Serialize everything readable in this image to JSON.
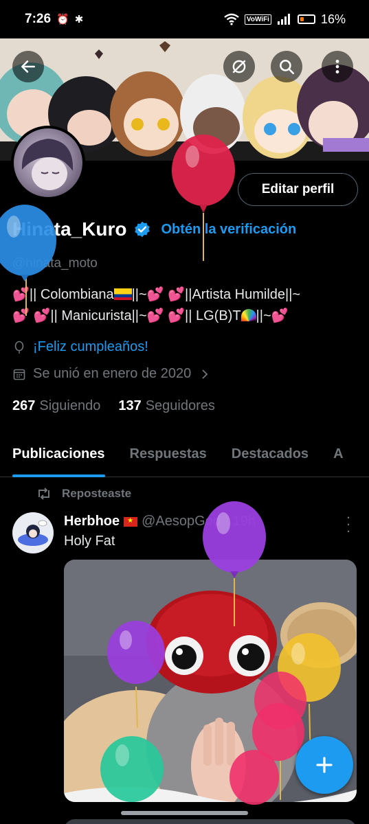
{
  "status_bar": {
    "time": "7:26",
    "alarm_icon": "alarm-icon",
    "bluetooth_icon": "bluetooth-icon",
    "wifi_icon": "wifi-icon",
    "vowifi_label": "VoWiFi",
    "signal_icon": "signal-icon",
    "battery_percent": "16%"
  },
  "header": {
    "back_icon": "back-arrow-icon",
    "mute_icon": "muted-icon",
    "search_icon": "search-icon",
    "more_icon": "more-vertical-icon"
  },
  "profile": {
    "display_name": "Hinata_Kuro",
    "verified_badge": "verified-badge-icon",
    "get_verified_label": "Obtén la verificación",
    "handle": "@hinata_moto",
    "edit_button": "Editar perfil",
    "bio_line1_a": "|| Colombiana",
    "bio_line1_b": "||~",
    "bio_line1_c": "||Artista Humilde||~",
    "bio_line2_a": "|| Manicurista||~",
    "bio_line2_b": "|| LG(B)T",
    "bio_line2_c": "||~",
    "birthday_text": "¡Feliz cumpleaños!",
    "joined_text": "Se unió en enero de 2020",
    "following_count": "267",
    "following_label": "Siguiendo",
    "followers_count": "137",
    "followers_label": "Seguidores"
  },
  "tabs": [
    {
      "label": "Publicaciones",
      "active": true
    },
    {
      "label": "Respuestas",
      "active": false
    },
    {
      "label": "Destacados",
      "active": false
    },
    {
      "label": "A",
      "active": false
    }
  ],
  "post": {
    "repost_label": "Reposteaste",
    "author": "Herbhoe",
    "handle_time": "@AesopGod · 19h",
    "text": "Holy Fat"
  },
  "colors": {
    "accent": "#1d9bf0",
    "background": "#000000",
    "muted_text": "#71767b"
  }
}
